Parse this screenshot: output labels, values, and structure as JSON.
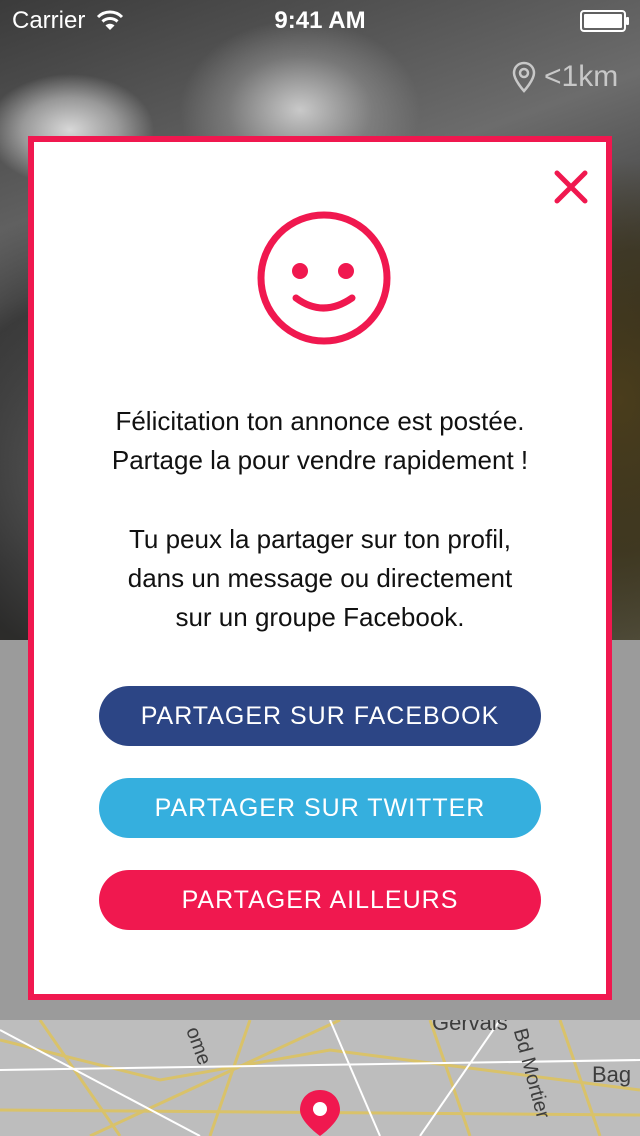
{
  "status_bar": {
    "carrier": "Carrier",
    "time": "9:41 AM"
  },
  "listing": {
    "distance": "<1km"
  },
  "map": {
    "labels": [
      "Gervais",
      "Bd Mortier",
      "Bag",
      "ome"
    ]
  },
  "modal": {
    "message_line1": "Félicitation ton annonce est postée.",
    "message_line2": "Partage la pour vendre rapidement !",
    "message_line3": "Tu peux la partager sur ton profil,",
    "message_line4": "dans un message ou directement",
    "message_line5": "sur un groupe Facebook.",
    "facebook_button": "PARTAGER SUR FACEBOOK",
    "twitter_button": "PARTAGER SUR TWITTER",
    "other_button": "PARTAGER AILLEURS"
  },
  "colors": {
    "accent": "#f0184f",
    "facebook": "#2c4585",
    "twitter": "#35afde"
  },
  "icons": [
    "wifi-icon",
    "battery-icon",
    "location-pin-icon",
    "close-icon",
    "smiley-icon",
    "map-pin-icon"
  ]
}
